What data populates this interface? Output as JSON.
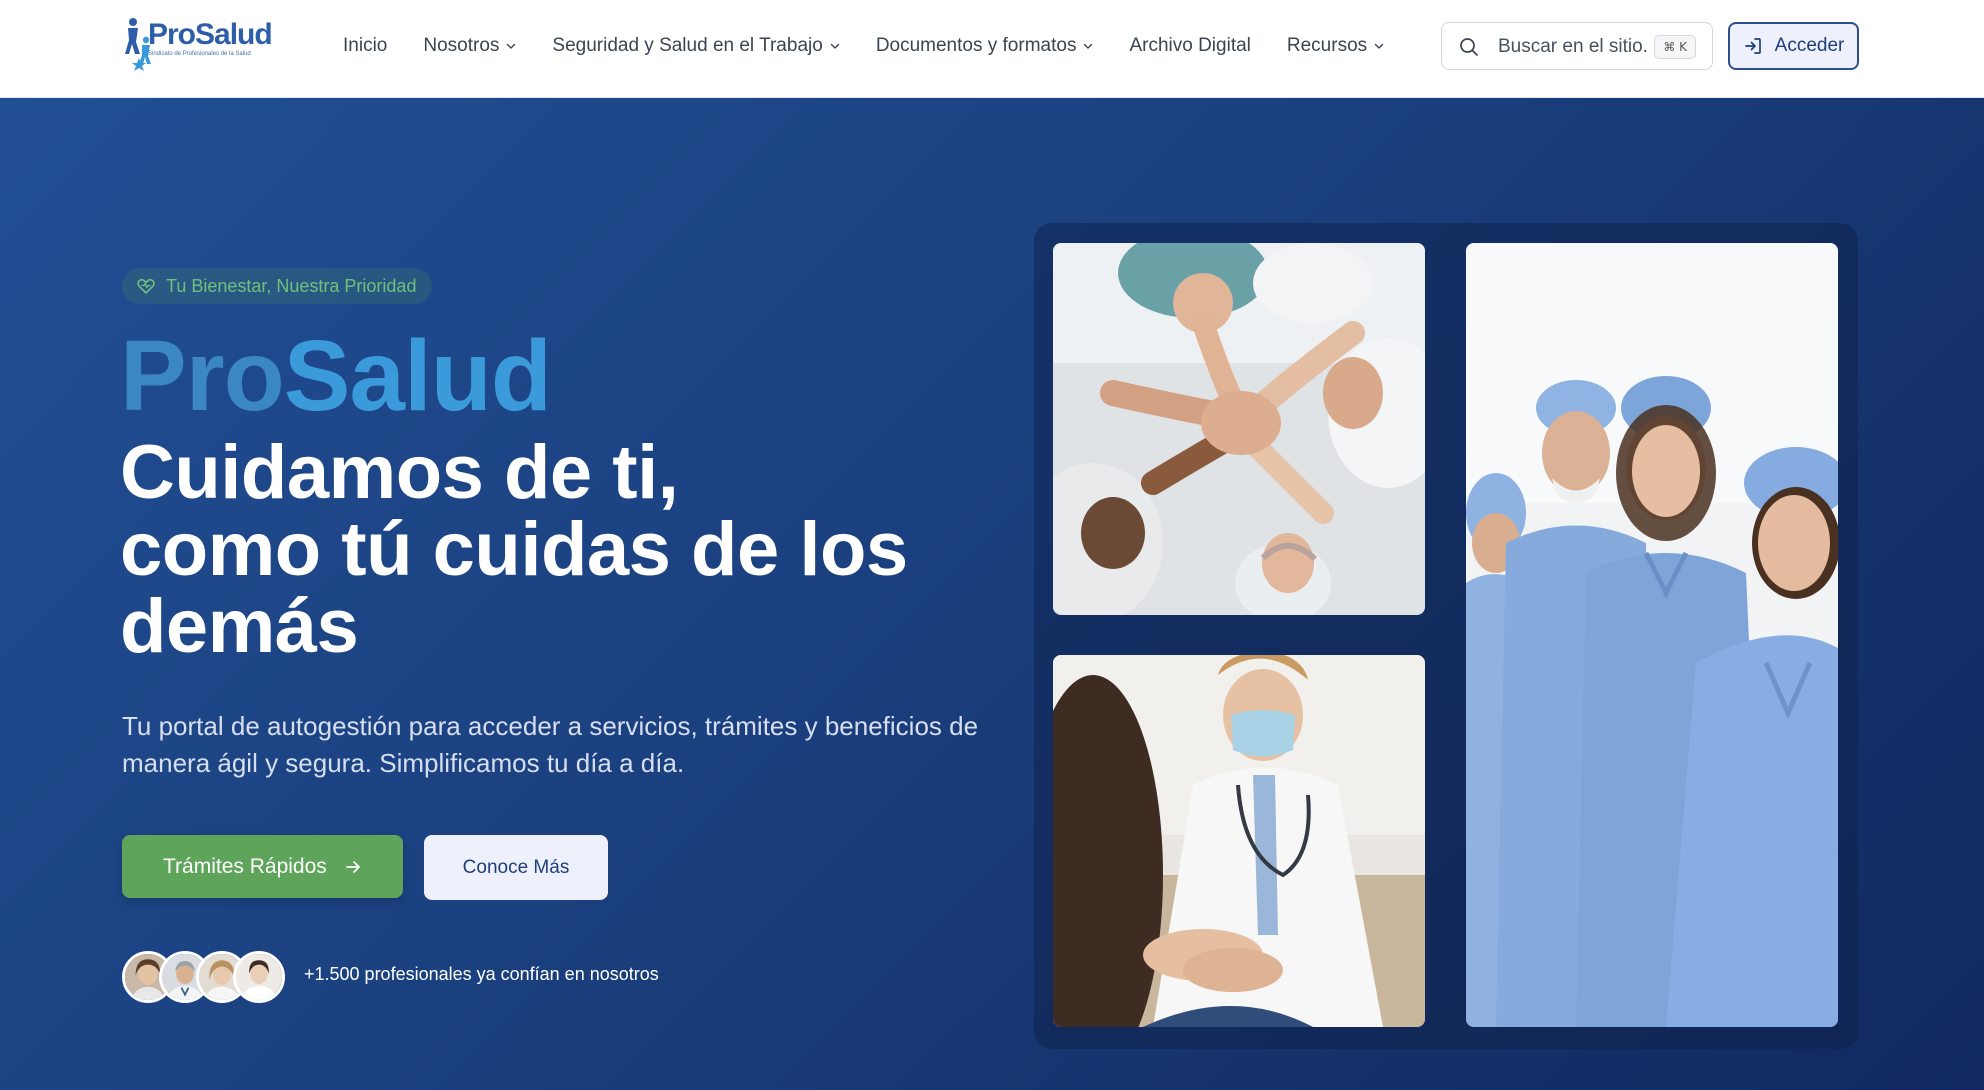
{
  "header": {
    "logo": {
      "wordmark": "ProSalud",
      "tagline": "Sindicato de Profesionales de la Salud",
      "icon": "people-star-logo-icon"
    },
    "nav": [
      {
        "label": "Inicio",
        "has_dropdown": false
      },
      {
        "label": "Nosotros",
        "has_dropdown": true
      },
      {
        "label": "Seguridad y Salud en el Trabajo",
        "has_dropdown": true
      },
      {
        "label": "Documentos y formatos",
        "has_dropdown": true
      },
      {
        "label": "Archivo Digital",
        "has_dropdown": false
      },
      {
        "label": "Recursos",
        "has_dropdown": true
      }
    ],
    "search": {
      "placeholder": "Buscar en el sitio...",
      "shortcut": "⌘ K",
      "icon": "search-icon"
    },
    "login": {
      "label": "Acceder",
      "icon": "login-arrow-icon"
    }
  },
  "hero": {
    "badge": {
      "icon": "heart-icon",
      "text": "Tu Bienestar, Nuestra Prioridad"
    },
    "brand_pro": "Pro",
    "brand_salud": "Salud",
    "headline_lines": [
      "Cuidamos de ti,",
      "como tú cuidas de los",
      "demás"
    ],
    "subtext": "Tu portal de autogestión para acceder a servicios, trámites y beneficios de manera ágil y segura. Simplificamos tu día a día.",
    "primary_button": "Trámites Rápidos",
    "secondary_button": "Conoce Más",
    "social_proof": "+1.500 profesionales ya confían en nosotros",
    "avatar_count": 4
  },
  "colors": {
    "brand_blue": "#2f5ea8",
    "hero_bg_start": "#214f94",
    "hero_bg_end": "#112960",
    "accent_green": "#5ea45a",
    "badge_green": "#6fc07e",
    "brand_light_blue": "#3b9ad9",
    "button_light": "#eef0fb"
  }
}
